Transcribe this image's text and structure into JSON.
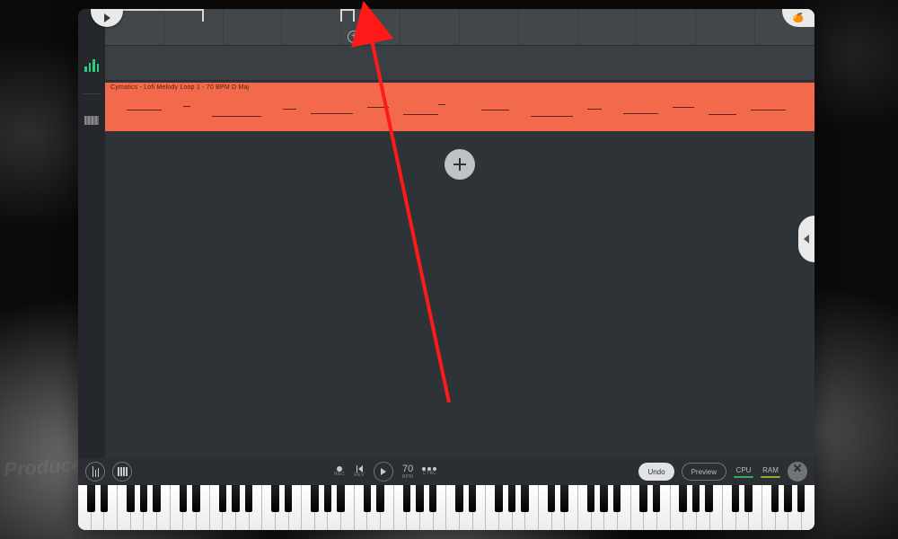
{
  "clip": {
    "label": "Cymatics - Lofi Melody Loop 1 - 70 BPM D Maj"
  },
  "transport": {
    "rec": "REC",
    "rev": "REV",
    "bpm_value": "70",
    "bpm_label": "BPM",
    "ctrl": "CTRL",
    "undo": "Undo",
    "preview": "Preview",
    "cpu": "CPU",
    "ram": "RAM"
  },
  "colors": {
    "clip": "#f26a4b",
    "accent_green": "#29d07a",
    "cpu_meter": "#2fae63",
    "ram_meter": "#8fae2f"
  },
  "watermark": "Producer Society"
}
